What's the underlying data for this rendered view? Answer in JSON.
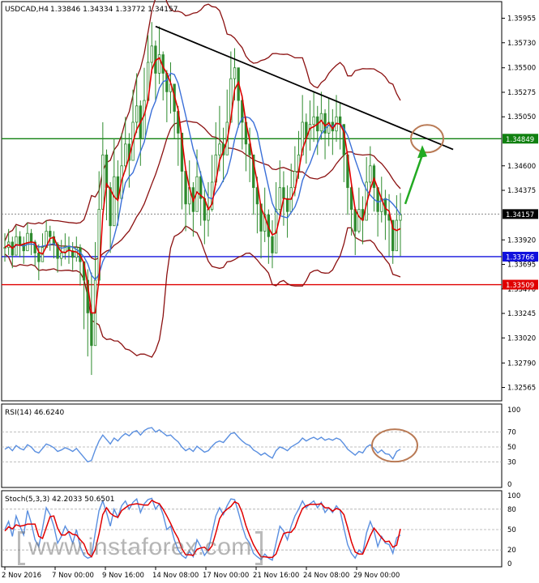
{
  "header": {
    "symbol": "USDCAD,H4",
    "ohlc": "1.33846 1.34334 1.33772 1.34157"
  },
  "colors": {
    "bull": "#2e8b2e",
    "bear": "#2e8b2e",
    "ma_fast": "#e00000",
    "ma_mid": "#3a6fd8",
    "bands": "#8b1010",
    "trendline": "#000000",
    "resistance": "#108010",
    "support": "#1010dd",
    "level3": "#e00000",
    "arrow": "#22aa22",
    "circle": "#b97a55",
    "rsi": "#5a8fe0",
    "stoch_k": "#5a8fe0",
    "stoch_d": "#e00000"
  },
  "chart_data": [
    {
      "type": "candlestick",
      "title": "USDCAD,H4",
      "ohlc_label": "1.33846 1.34334 1.33772 1.34157",
      "ylim": [
        1.3245,
        1.361
      ],
      "y_ticks": [
        "1.35955",
        "1.35730",
        "1.35500",
        "1.35275",
        "1.35050",
        "1.34600",
        "1.34375",
        "1.33920",
        "1.33695",
        "1.33470",
        "1.33245",
        "1.33020",
        "1.32790",
        "1.32565"
      ],
      "x_ticks": [
        "2 Nov 2016",
        "7 Nov 00:00",
        "9 Nov 16:00",
        "14 Nov 08:00",
        "17 Nov 00:00",
        "21 Nov 16:00",
        "24 Nov 08:00",
        "29 Nov 00:00"
      ],
      "levels": [
        {
          "label": "1.34849",
          "value": 1.34849
        },
        {
          "label": "1.34157",
          "value": 1.34157
        },
        {
          "label": "1.33766",
          "value": 1.33766
        },
        {
          "label": "1.33509",
          "value": 1.33509
        }
      ],
      "trendline": {
        "from_bar": 40,
        "from_value": 1.3588,
        "to_bar": 119,
        "to_value": 1.3475
      },
      "close": [
        1.3385,
        1.339,
        1.3378,
        1.3395,
        1.3388,
        1.3382,
        1.3398,
        1.339,
        1.338,
        1.3372,
        1.3385,
        1.34,
        1.3395,
        1.3388,
        1.3375,
        1.338,
        1.3386,
        1.3382,
        1.3376,
        1.3385,
        1.3372,
        1.3355,
        1.3325,
        1.3295,
        1.3355,
        1.342,
        1.347,
        1.344,
        1.3405,
        1.345,
        1.343,
        1.346,
        1.348,
        1.3465,
        1.35,
        1.3515,
        1.3485,
        1.352,
        1.3555,
        1.357,
        1.3545,
        1.3562,
        1.3545,
        1.3528,
        1.3535,
        1.351,
        1.349,
        1.3455,
        1.3425,
        1.344,
        1.3418,
        1.345,
        1.343,
        1.341,
        1.342,
        1.3445,
        1.347,
        1.348,
        1.347,
        1.35,
        1.354,
        1.355,
        1.352,
        1.35,
        1.348,
        1.347,
        1.344,
        1.3425,
        1.34,
        1.3415,
        1.3395,
        1.338,
        1.342,
        1.344,
        1.343,
        1.3418,
        1.344,
        1.3455,
        1.347,
        1.35,
        1.3485,
        1.3498,
        1.3505,
        1.3492,
        1.3508,
        1.349,
        1.35,
        1.3492,
        1.3505,
        1.3498,
        1.347,
        1.344,
        1.342,
        1.34,
        1.342,
        1.341,
        1.3445,
        1.346,
        1.344,
        1.3418,
        1.343,
        1.3415,
        1.341,
        1.3382,
        1.341,
        1.3415
      ],
      "high": [
        1.3398,
        1.3402,
        1.3395,
        1.3405,
        1.34,
        1.3395,
        1.3408,
        1.3402,
        1.3392,
        1.3388,
        1.3398,
        1.341,
        1.3405,
        1.34,
        1.339,
        1.3392,
        1.3398,
        1.3395,
        1.339,
        1.3395,
        1.3388,
        1.3372,
        1.3365,
        1.3362,
        1.339,
        1.3455,
        1.35,
        1.3475,
        1.3445,
        1.3485,
        1.3465,
        1.349,
        1.3505,
        1.349,
        1.353,
        1.3545,
        1.352,
        1.355,
        1.358,
        1.3592,
        1.3575,
        1.3588,
        1.3565,
        1.3548,
        1.3555,
        1.3535,
        1.3515,
        1.349,
        1.3455,
        1.3465,
        1.3445,
        1.3475,
        1.3455,
        1.3438,
        1.3445,
        1.347,
        1.35,
        1.3515,
        1.3495,
        1.353,
        1.3565,
        1.3568,
        1.3545,
        1.3525,
        1.3505,
        1.3495,
        1.3465,
        1.345,
        1.3425,
        1.344,
        1.342,
        1.341,
        1.3445,
        1.3465,
        1.3455,
        1.3442,
        1.3462,
        1.3478,
        1.3492,
        1.3525,
        1.3508,
        1.352,
        1.3528,
        1.3515,
        1.3528,
        1.3512,
        1.3522,
        1.3512,
        1.3525,
        1.3518,
        1.3495,
        1.3465,
        1.3442,
        1.3422,
        1.344,
        1.3432,
        1.3468,
        1.3478,
        1.3462,
        1.344,
        1.345,
        1.3438,
        1.3434,
        1.341,
        1.3433,
        1.3435
      ],
      "low": [
        1.3372,
        1.3378,
        1.3366,
        1.3382,
        1.3376,
        1.337,
        1.3385,
        1.3378,
        1.3368,
        1.3355,
        1.3372,
        1.3388,
        1.3382,
        1.3375,
        1.3362,
        1.3368,
        1.3374,
        1.337,
        1.3364,
        1.3372,
        1.335,
        1.331,
        1.3285,
        1.3268,
        1.33,
        1.335,
        1.342,
        1.341,
        1.338,
        1.342,
        1.3405,
        1.343,
        1.3455,
        1.344,
        1.347,
        1.349,
        1.346,
        1.3495,
        1.353,
        1.3545,
        1.352,
        1.3535,
        1.352,
        1.35,
        1.3508,
        1.3485,
        1.346,
        1.342,
        1.34,
        1.3415,
        1.3395,
        1.342,
        1.3405,
        1.3388,
        1.3395,
        1.3418,
        1.3442,
        1.3455,
        1.3445,
        1.3475,
        1.351,
        1.352,
        1.3495,
        1.3475,
        1.3455,
        1.3445,
        1.3415,
        1.3398,
        1.3375,
        1.339,
        1.337,
        1.3366,
        1.3395,
        1.3415,
        1.3405,
        1.3394,
        1.3418,
        1.3432,
        1.3448,
        1.3475,
        1.3462,
        1.3474,
        1.3482,
        1.347,
        1.3484,
        1.3466,
        1.3478,
        1.347,
        1.3482,
        1.3475,
        1.3445,
        1.3415,
        1.3396,
        1.3378,
        1.3398,
        1.3388,
        1.342,
        1.3436,
        1.3418,
        1.3395,
        1.3408,
        1.3392,
        1.3377,
        1.337,
        1.3388,
        1.3377
      ]
    },
    {
      "type": "line",
      "title": "RSI(14) 46.6240",
      "ylim": [
        0,
        100
      ],
      "y_ticks": [
        "100",
        "70",
        "50",
        "30",
        "0"
      ],
      "series": [
        {
          "name": "RSI(14)",
          "values": [
            47,
            50,
            45,
            52,
            48,
            46,
            53,
            50,
            44,
            42,
            48,
            54,
            52,
            49,
            44,
            46,
            49,
            47,
            44,
            48,
            42,
            36,
            30,
            32,
            46,
            58,
            66,
            60,
            54,
            62,
            58,
            64,
            68,
            65,
            70,
            72,
            66,
            72,
            75,
            76,
            70,
            73,
            69,
            65,
            66,
            61,
            57,
            50,
            45,
            48,
            44,
            51,
            47,
            43,
            45,
            51,
            56,
            58,
            56,
            62,
            68,
            69,
            63,
            58,
            54,
            52,
            46,
            43,
            39,
            42,
            38,
            35,
            45,
            50,
            48,
            45,
            50,
            53,
            56,
            62,
            58,
            61,
            63,
            60,
            63,
            59,
            61,
            59,
            62,
            60,
            54,
            47,
            43,
            39,
            44,
            42,
            50,
            53,
            48,
            42,
            46,
            41,
            40,
            34,
            44,
            47
          ]
        }
      ]
    },
    {
      "type": "line",
      "title": "Stoch(5,3,3) 42.2033 50.6501",
      "ylim": [
        0,
        100
      ],
      "y_ticks": [
        "100",
        "80",
        "50",
        "20",
        "0"
      ],
      "series": [
        {
          "name": "Stoch %K",
          "values": [
            50,
            62,
            40,
            70,
            55,
            42,
            78,
            60,
            35,
            25,
            52,
            82,
            72,
            55,
            30,
            40,
            55,
            45,
            30,
            50,
            25,
            12,
            8,
            10,
            45,
            78,
            92,
            75,
            55,
            80,
            68,
            85,
            92,
            80,
            90,
            95,
            75,
            88,
            94,
            96,
            80,
            88,
            72,
            50,
            55,
            35,
            20,
            12,
            8,
            18,
            10,
            35,
            25,
            12,
            20,
            45,
            70,
            82,
            72,
            85,
            95,
            94,
            75,
            55,
            38,
            30,
            15,
            10,
            6,
            14,
            8,
            5,
            30,
            55,
            48,
            35,
            55,
            70,
            80,
            92,
            82,
            88,
            92,
            82,
            90,
            75,
            82,
            75,
            85,
            78,
            52,
            28,
            15,
            8,
            20,
            15,
            45,
            62,
            48,
            25,
            40,
            30,
            28,
            15,
            38,
            42
          ]
        },
        {
          "name": "Stoch %D",
          "values": [
            48,
            54,
            51,
            57,
            55,
            56,
            58,
            58,
            58,
            40,
            37,
            53,
            69,
            70,
            52,
            42,
            42,
            47,
            43,
            42,
            35,
            29,
            15,
            10,
            21,
            44,
            72,
            82,
            74,
            70,
            68,
            78,
            82,
            86,
            87,
            88,
            87,
            86,
            86,
            93,
            90,
            88,
            80,
            70,
            59,
            47,
            37,
            22,
            13,
            13,
            12,
            21,
            23,
            24,
            19,
            26,
            45,
            66,
            75,
            80,
            84,
            91,
            88,
            75,
            56,
            41,
            28,
            18,
            10,
            10,
            9,
            9,
            14,
            30,
            44,
            46,
            46,
            53,
            68,
            81,
            85,
            87,
            87,
            87,
            88,
            82,
            82,
            77,
            81,
            79,
            72,
            53,
            32,
            17,
            14,
            14,
            27,
            41,
            52,
            45,
            38,
            32,
            33,
            24,
            27,
            51
          ]
        }
      ]
    }
  ],
  "watermark": "www.instaforex.com"
}
